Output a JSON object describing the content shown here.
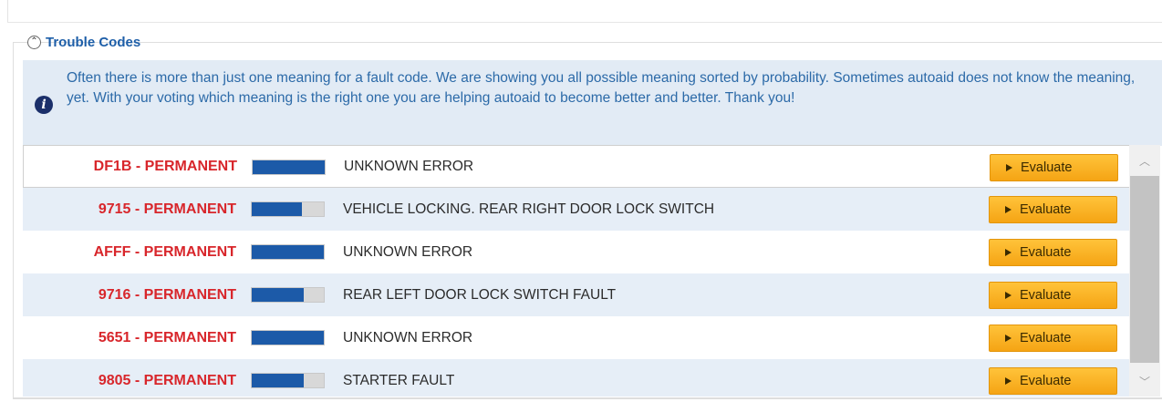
{
  "section": {
    "title": "Trouble Codes",
    "collapse_icon": "collapse-up-icon"
  },
  "info": {
    "icon": "info-icon",
    "text": "Often there is more than just one meaning for a fault code. We are showing you all possible meaning sorted by probability. Sometimes autoaid does not know the meaning, yet. With your voting which meaning is the right one you are helping autoaid to become better and better. Thank you!"
  },
  "colors": {
    "title": "#1d5ea8",
    "code": "#d8262b",
    "info_bg": "#e2ebf5",
    "probability_fill": "#1c5aa8",
    "button": "#f5a414"
  },
  "rows": [
    {
      "code": "DF1B - PERMANENT",
      "probability": 1.0,
      "meaning": "UNKNOWN ERROR",
      "button": "Evaluate"
    },
    {
      "code": "9715 - PERMANENT",
      "probability": 0.7,
      "meaning": "VEHICLE LOCKING. REAR RIGHT DOOR LOCK SWITCH",
      "button": "Evaluate"
    },
    {
      "code": "AFFF - PERMANENT",
      "probability": 1.0,
      "meaning": "UNKNOWN ERROR",
      "button": "Evaluate"
    },
    {
      "code": "9716 - PERMANENT",
      "probability": 0.72,
      "meaning": "REAR LEFT DOOR LOCK SWITCH FAULT",
      "button": "Evaluate"
    },
    {
      "code": "5651 - PERMANENT",
      "probability": 1.0,
      "meaning": "UNKNOWN ERROR",
      "button": "Evaluate"
    },
    {
      "code": "9805 - PERMANENT",
      "probability": 0.72,
      "meaning": "STARTER FAULT",
      "button": "Evaluate"
    }
  ],
  "scrollbar": {
    "up_icon": "chevron-up-icon",
    "down_icon": "chevron-down-icon"
  }
}
